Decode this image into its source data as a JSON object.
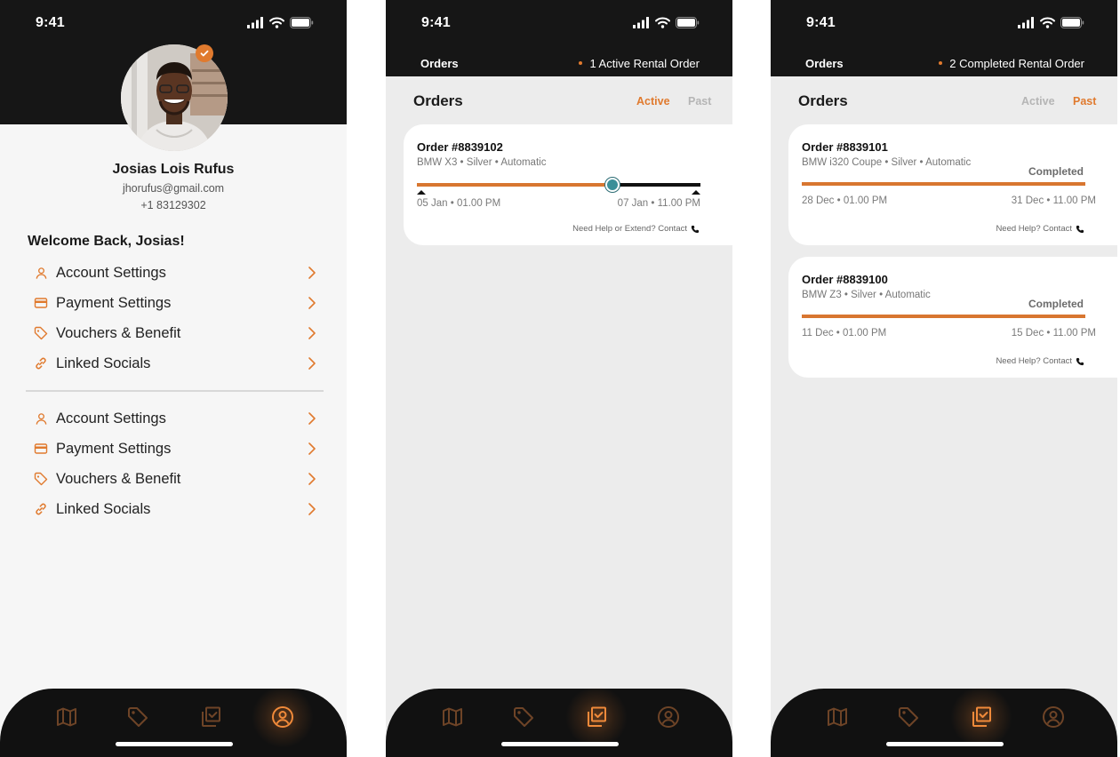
{
  "colors": {
    "accent": "#e07a2e",
    "dark": "#161616",
    "progress_knob": "#3b8f98"
  },
  "status_bar": {
    "time": "9:41",
    "icons": [
      "cellular-signal-icon",
      "wifi-icon",
      "battery-icon"
    ]
  },
  "profile_screen": {
    "name": "Josias Lois Rufus",
    "email": "jhorufus@gmail.com",
    "phone": "+1 83129302",
    "verified": true,
    "welcome": "Welcome Back, Josias!",
    "menu_group_1": [
      {
        "label": "Account Settings",
        "icon": "user-icon"
      },
      {
        "label": "Payment Settings",
        "icon": "credit-card-icon"
      },
      {
        "label": "Vouchers & Benefit",
        "icon": "tag-icon"
      },
      {
        "label": "Linked Socials",
        "icon": "link-icon"
      }
    ],
    "menu_group_2": [
      {
        "label": "Account Settings",
        "icon": "user-icon"
      },
      {
        "label": "Payment Settings",
        "icon": "credit-card-icon"
      },
      {
        "label": "Vouchers & Benefit",
        "icon": "tag-icon"
      },
      {
        "label": "Linked Socials",
        "icon": "link-icon"
      }
    ],
    "active_tab": "profile"
  },
  "tabbar": {
    "tabs": [
      {
        "name": "map",
        "icon": "map-icon"
      },
      {
        "name": "vouchers",
        "icon": "tag-icon"
      },
      {
        "name": "orders",
        "icon": "orders-check-icon"
      },
      {
        "name": "profile",
        "icon": "user-circle-icon"
      }
    ]
  },
  "orders_active_screen": {
    "header_title": "Orders",
    "header_count": "1 Active Rental Order",
    "section_title": "Orders",
    "segments": [
      {
        "label": "Active",
        "selected": true
      },
      {
        "label": "Past",
        "selected": false
      }
    ],
    "orders": [
      {
        "title": "Order #8839102",
        "subtitle": "BMW X3 • Silver • Automatic",
        "start": "05 Jan • 01.00 PM",
        "end": "07 Jan • 11.00 PM",
        "progress_percent": 69,
        "help_text": "Need Help or Extend? Contact"
      }
    ],
    "active_tab": "orders"
  },
  "orders_past_screen": {
    "header_title": "Orders",
    "header_count": "2 Completed Rental Order",
    "section_title": "Orders",
    "segments": [
      {
        "label": "Active",
        "selected": false
      },
      {
        "label": "Past",
        "selected": true
      }
    ],
    "orders": [
      {
        "title": "Order #8839101",
        "subtitle": "BMW i320 Coupe • Silver • Automatic",
        "status": "Completed",
        "start": "28 Dec • 01.00 PM",
        "end": "31 Dec • 11.00 PM",
        "progress_percent": 100,
        "help_text": "Need Help? Contact"
      },
      {
        "title": "Order #8839100",
        "subtitle": "BMW Z3 • Silver • Automatic",
        "status": "Completed",
        "start": "11 Dec • 01.00 PM",
        "end": "15 Dec • 11.00 PM",
        "progress_percent": 100,
        "help_text": "Need Help? Contact"
      }
    ],
    "active_tab": "orders"
  }
}
